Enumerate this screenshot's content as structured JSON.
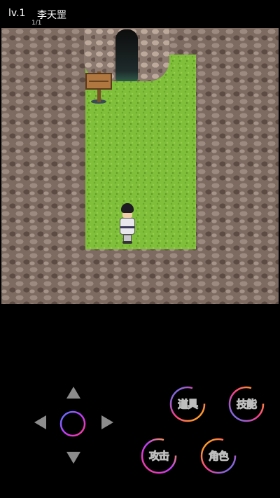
{
  "hud": {
    "level": "lv.1",
    "player_name": "李天罡",
    "page": "1/1"
  },
  "map": {
    "grass_color": "#7fbf3a",
    "rock_color": "#7d6a60",
    "cave_color": "#1e2a2a"
  },
  "dpad": {
    "up_icon": "arrow-up-icon",
    "down_icon": "arrow-down-icon",
    "left_icon": "arrow-left-icon",
    "right_icon": "arrow-right-icon",
    "joystick_icon": "joystick-ring-icon"
  },
  "actions": {
    "button1": "道具",
    "button2": "技能",
    "button3": "攻击",
    "button4": "角色"
  },
  "colors": {
    "ring_start": "#ff3c8c",
    "ring_end": "#ffc000",
    "ring_alt": "#5078ff"
  }
}
